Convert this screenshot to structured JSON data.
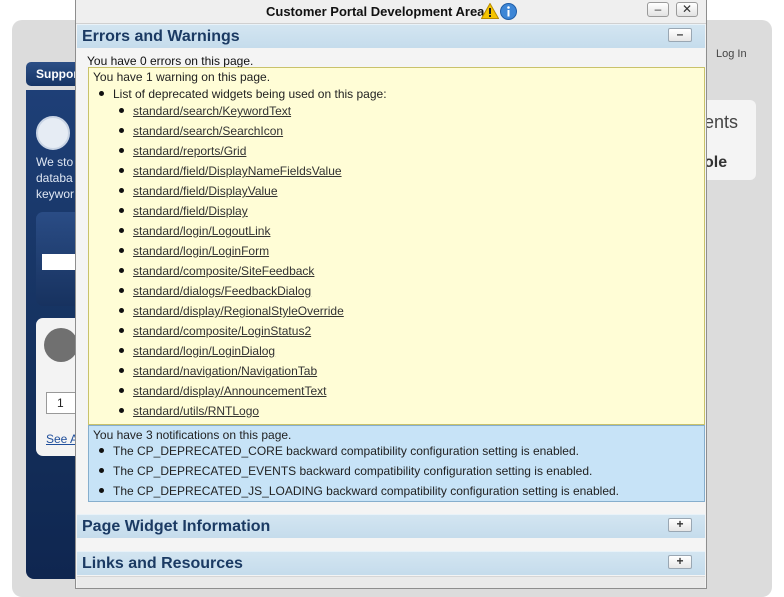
{
  "background": {
    "login_link": "Log In",
    "support_tab": "Suppor",
    "left_text_lines": [
      "We sto",
      "databa",
      "keywor"
    ],
    "number_box": "1",
    "see_link": "See A",
    "right_text_1": "ents",
    "right_text_2": "ole"
  },
  "dialog": {
    "title": "Customer Portal Development Area",
    "minimize_label": "–",
    "close_label": "✕",
    "warning_icon": "warning-triangle-icon",
    "info_icon": "info-circle-icon"
  },
  "errors_section": {
    "title": "Errors and Warnings",
    "toggle_label": "–",
    "errors_summary": "You have 0 errors on this page.",
    "warnings_summary": "You have 1 warning on this page.",
    "deprecated_heading": "List of deprecated widgets being used on this page:",
    "deprecated_widgets": [
      "standard/search/KeywordText",
      "standard/search/SearchIcon",
      "standard/reports/Grid",
      "standard/field/DisplayNameFieldsValue",
      "standard/field/DisplayValue",
      "standard/field/Display",
      "standard/login/LogoutLink",
      "standard/login/LoginForm",
      "standard/composite/SiteFeedback",
      "standard/dialogs/FeedbackDialog",
      "standard/display/RegionalStyleOverride",
      "standard/composite/LoginStatus2",
      "standard/login/LoginDialog",
      "standard/navigation/NavigationTab",
      "standard/display/AnnouncementText",
      "standard/utils/RNTLogo"
    ],
    "notifications_summary": "You have 3 notifications on this page.",
    "notifications": [
      "The CP_DEPRECATED_CORE backward compatibility configuration setting is enabled.",
      "The CP_DEPRECATED_EVENTS backward compatibility configuration setting is enabled.",
      "The CP_DEPRECATED_JS_LOADING backward compatibility configuration setting is enabled."
    ]
  },
  "widget_section": {
    "title": "Page Widget Information",
    "toggle_label": "+"
  },
  "links_section": {
    "title": "Links and Resources",
    "toggle_label": "+"
  },
  "colors": {
    "section_header": "#c5dcec",
    "section_title": "#1b3a63",
    "warning_box": "#fffdd6",
    "notification_box": "#c7e3f7",
    "background_nav": "#1e3f77"
  }
}
